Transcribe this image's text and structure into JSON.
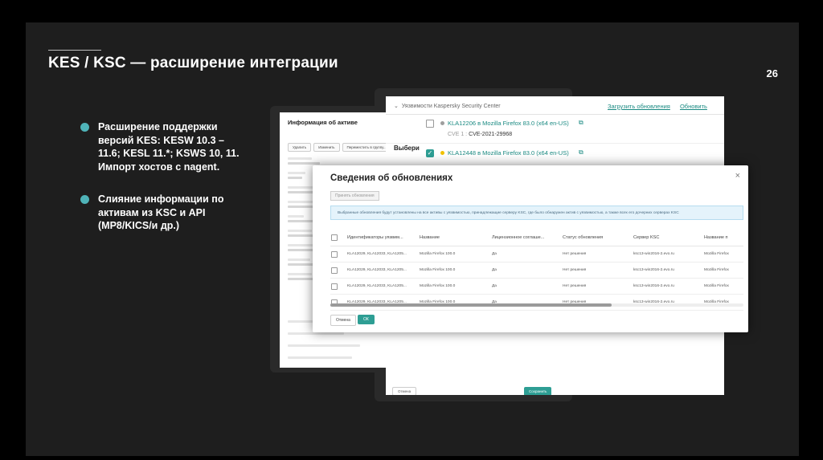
{
  "slide": {
    "title": "KES / KSC — расширение интеграции",
    "page_number": "26",
    "bullets": [
      "Расширение поддержки версий KES: KESW 10.3 – 11.6; KESL 11.*; KSWS 10, 11. Импорт хостов с nagent.",
      "Слияние информации по активам из KSC и API (MP8/KICS/и др.)"
    ]
  },
  "asset_panel": {
    "title": "Информация об активе",
    "buttons": [
      "Удалить",
      "Изменить",
      "Переместить в группу..."
    ],
    "side_label": "Выбери"
  },
  "vuln_panel": {
    "header": "Уязвимости Kaspersky Security Center",
    "load_link": "Загрузить обновления",
    "refresh_link": "Обновить",
    "items": [
      {
        "title": "KLA12206 в Mozilla Firefox 83.0 (x64 en-US)",
        "cve_label": "CVE 1 :",
        "cve": "CVE-2021-29968",
        "checked": false,
        "dot": "#9e9e9e"
      },
      {
        "title": "KLA12448 в Mozilla Firefox 83.0 (x64 en-US)",
        "checked": true,
        "dot": "#f2c200"
      }
    ],
    "cancel_label": "Отмена",
    "save_label": "Сохранить"
  },
  "dialog": {
    "title": "Сведения об обновлениях",
    "close": "×",
    "install_button": "Принять обновления",
    "info": "Выбранные обновления будут установлены на все активы с уязвимостью, принадлежащие серверу KSC, где было обнаружен актив с уязвимостью, а также всех его дочерних серверах KSC",
    "columns": [
      "Идентификаторы уязвим...",
      "Название",
      "Лицензионное соглаше...",
      "Статус обновления",
      "Сервер KSC",
      "Название п"
    ],
    "rows": [
      [
        "KLA12029, KLA12033, KLA1205...",
        "Mozilla Firefox 100.0",
        "Да",
        "Нет решения",
        "ksc13-win2016-2.evo.ru",
        "Mozilla Firefox"
      ],
      [
        "KLA12029, KLA12033, KLA1205...",
        "Mozilla Firefox 100.0",
        "Да",
        "Нет решения",
        "ksc13-win2016-2.evo.ru",
        "Mozilla Firefox"
      ],
      [
        "KLA12029, KLA12033, KLA1205...",
        "Mozilla Firefox 100.0",
        "Да",
        "Нет решения",
        "ksc13-win2016-2.evo.ru",
        "Mozilla Firefox"
      ],
      [
        "KLA12029, KLA12033, KLA1205...",
        "Mozilla Firefox 100.0",
        "Да",
        "Нет решения",
        "ksc13-win2016-2.evo.ru",
        "Mozilla Firefox"
      ]
    ],
    "cancel_label": "Отмена",
    "ok_label": "ОК"
  },
  "colors": {
    "accent": "#4fb3b8",
    "ok": "#2e9e94",
    "link": "#1a8a82"
  }
}
